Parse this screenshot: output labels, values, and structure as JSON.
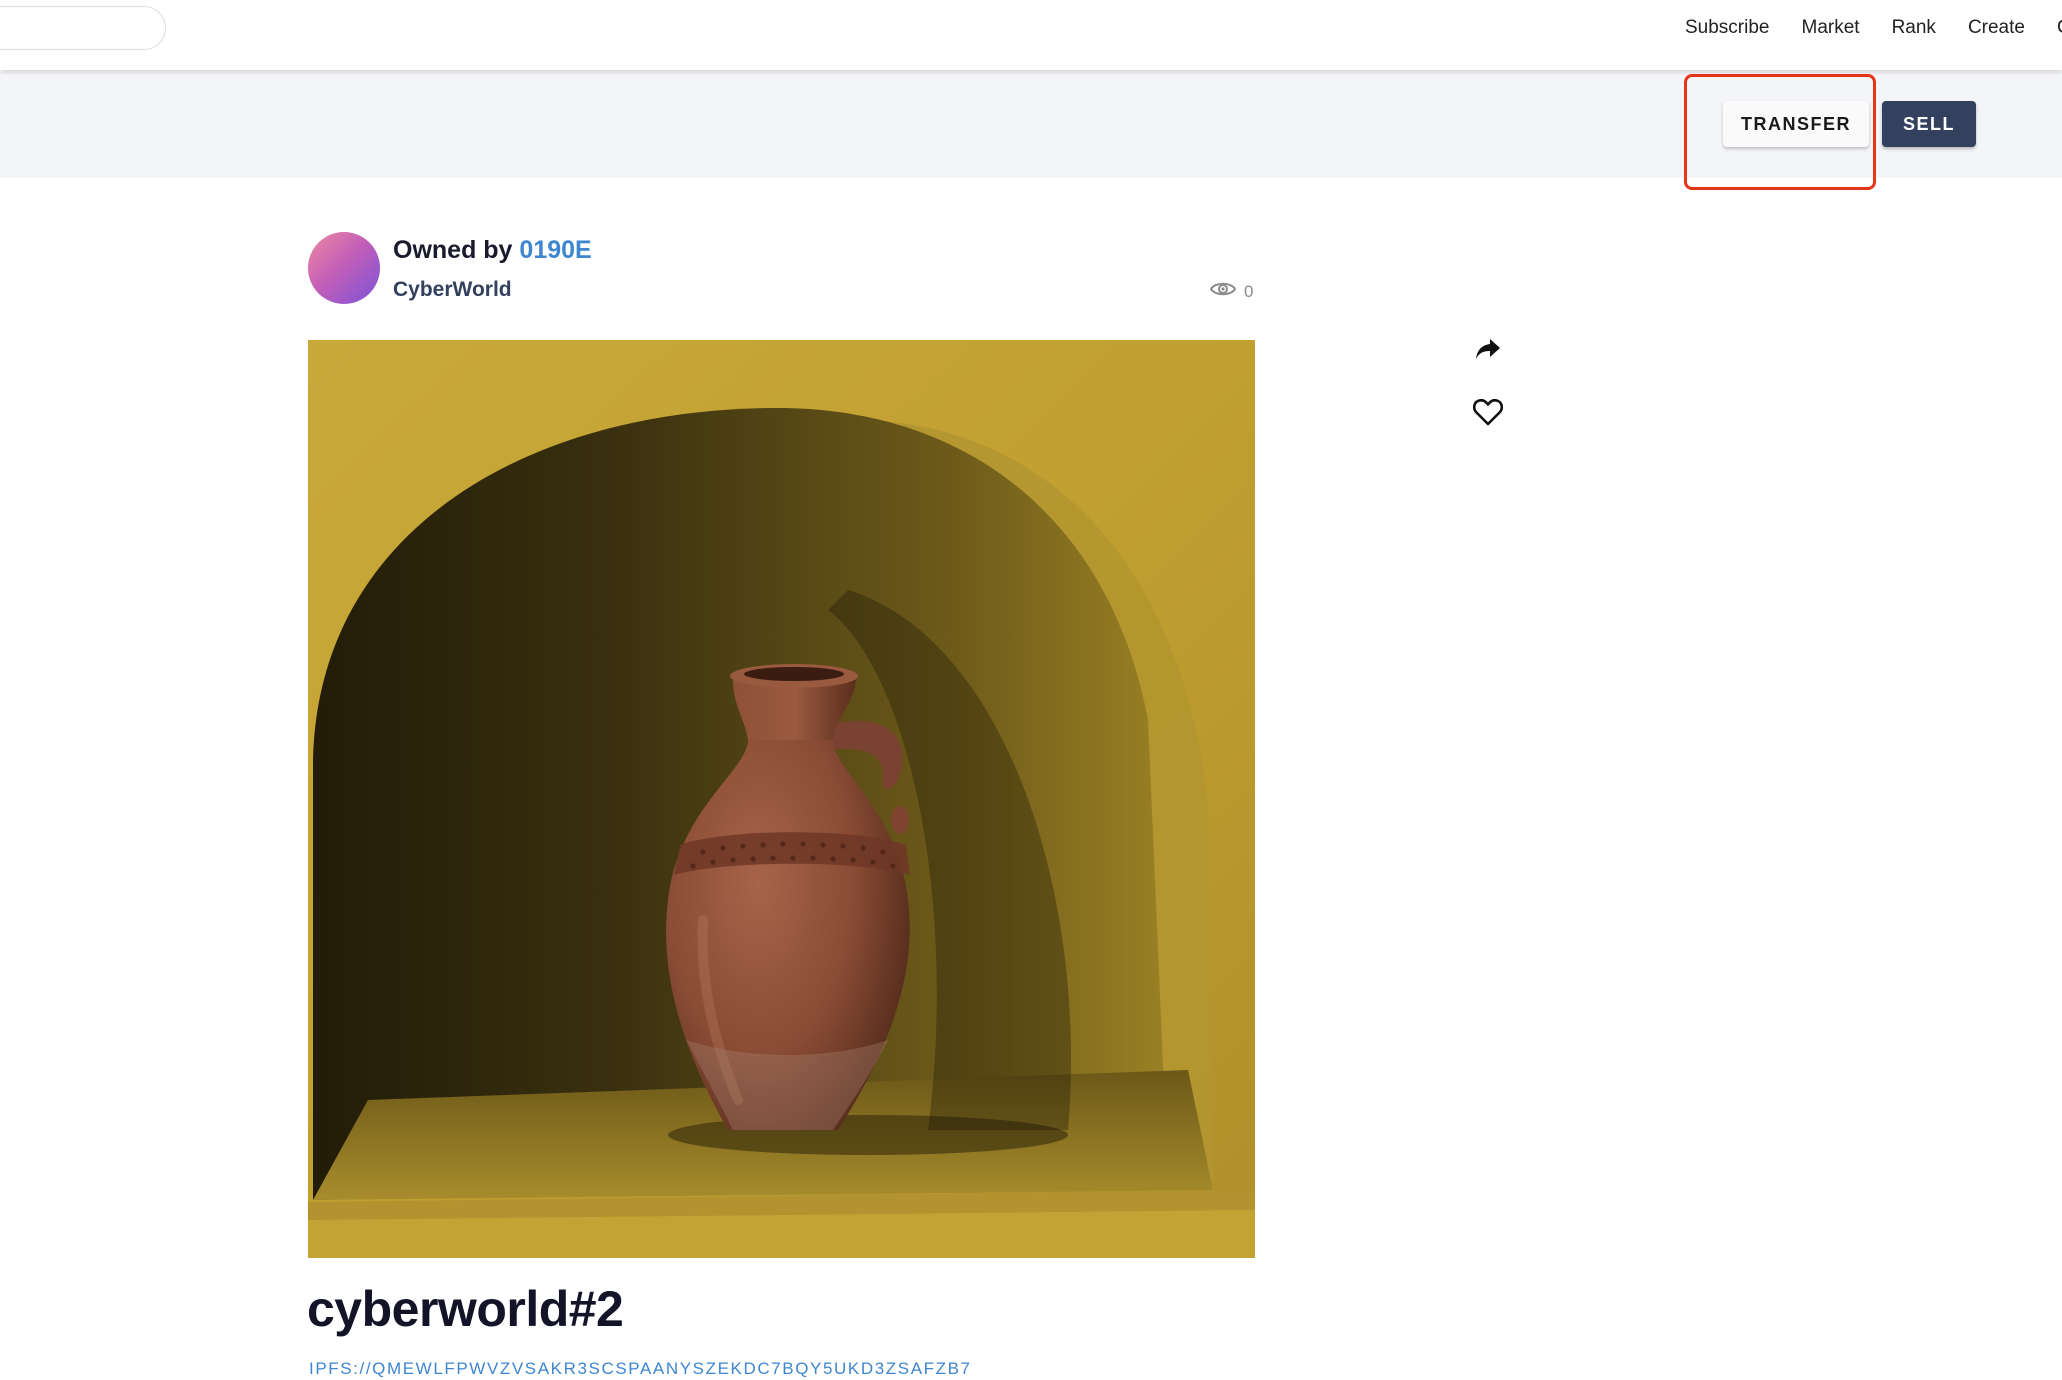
{
  "nav": {
    "search_placeholder": "",
    "items": [
      {
        "label": "Subscribe"
      },
      {
        "label": "Market"
      },
      {
        "label": "Rank"
      },
      {
        "label": "Create"
      },
      {
        "label": "C"
      }
    ]
  },
  "actions": {
    "transfer_label": "TRANSFER",
    "sell_label": "SELL",
    "highlight_color": "#e5361d",
    "sell_color": "#33415f"
  },
  "owner": {
    "prefix": "Owned by",
    "id": "0190E",
    "collection": "CyberWorld",
    "avatar": "gradient-avatar"
  },
  "stats": {
    "views": "0",
    "views_icon": "eye-icon"
  },
  "side_actions": {
    "share_icon": "share-icon",
    "like_icon": "heart-icon"
  },
  "artwork": {
    "subject": "clay jug in yellow wall niche"
  },
  "nft": {
    "title": "cyberworld#2",
    "ipfs": "IPFS://QMEWLFPWVZVSAKR3SCSPAANYSZEKDC7BQY5UKD3ZSAFZB7"
  },
  "colors": {
    "link": "#3e86cf",
    "text_dark": "#1a1a2e",
    "band_bg": "#f4f5f9"
  }
}
